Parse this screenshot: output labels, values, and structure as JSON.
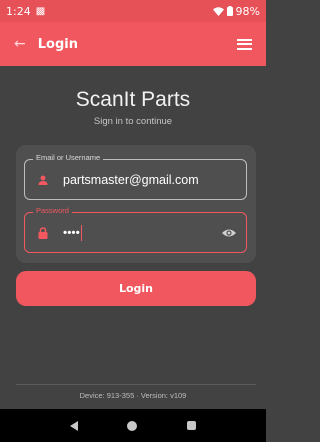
{
  "status": {
    "time": "1:24",
    "battery": "98%",
    "colors": {
      "bar": "#e65158"
    }
  },
  "app_bar": {
    "title": "Login",
    "back_icon": "arrow-back-icon",
    "menu_icon": "hamburger-menu-icon"
  },
  "brand": {
    "title": "ScanIt Parts",
    "subtitle": "Sign in to continue"
  },
  "form": {
    "email": {
      "label": "Email or Username",
      "value": "partsmaster@gmail.com",
      "icon": "person-icon"
    },
    "password": {
      "label": "Password",
      "masked_value": "••••",
      "icon": "lock-icon",
      "toggle_icon": "eye-icon"
    }
  },
  "login_button": {
    "label": "Login"
  },
  "footer": {
    "text": "Device: 913-355 · Version: v109"
  },
  "colors": {
    "accent": "#f0575e",
    "background": "#424242",
    "card": "#4f4f4f"
  }
}
